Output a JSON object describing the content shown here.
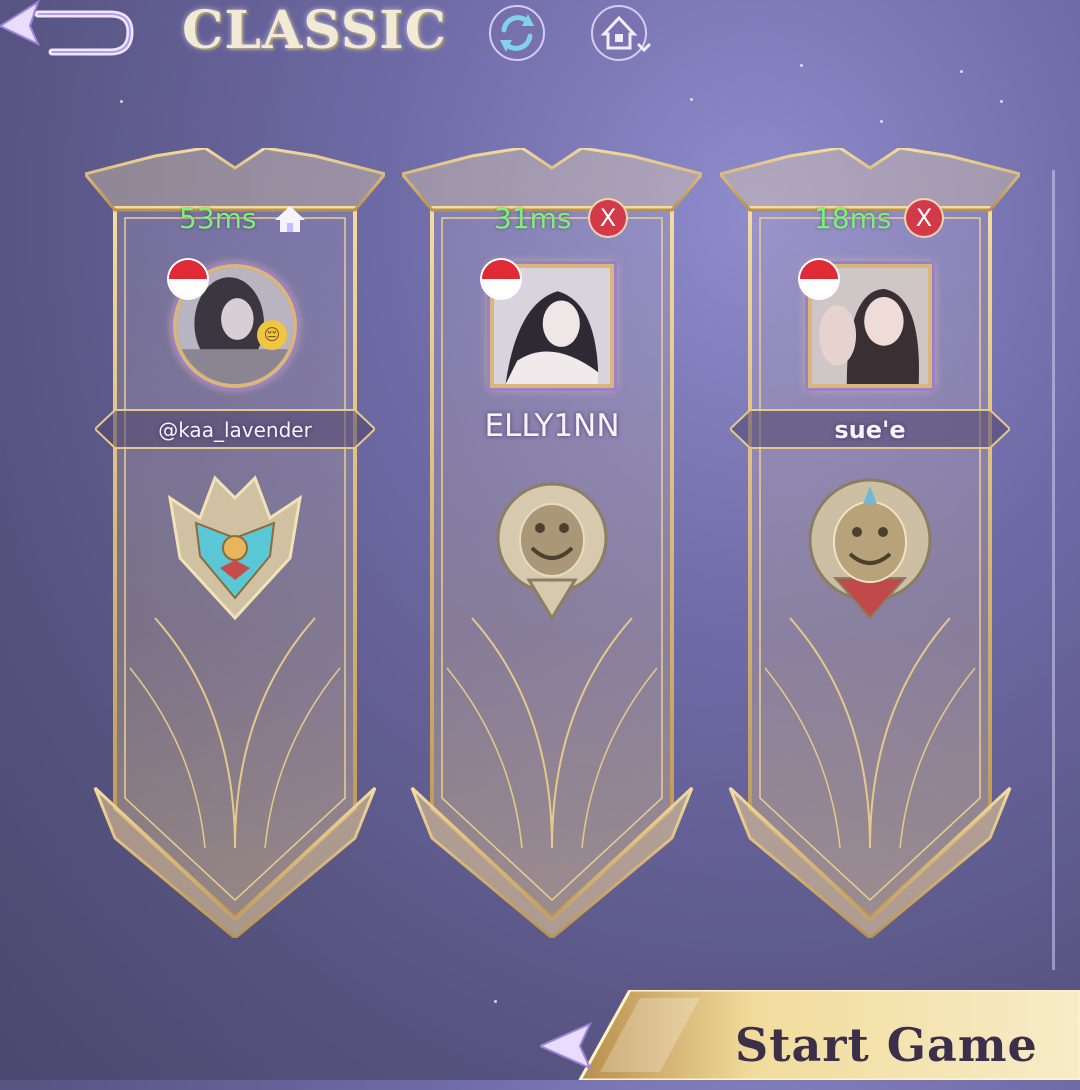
{
  "header": {
    "title": "CLASSIC"
  },
  "players": [
    {
      "ping": "53ms",
      "status": "host",
      "name": "@kaa_lavender",
      "flag": "red-white",
      "emoji": "😔"
    },
    {
      "ping": "31ms",
      "status": "X",
      "name": "ELLY1NN",
      "flag": "red-white"
    },
    {
      "ping": "18ms",
      "status": "X",
      "name": "sue'e",
      "flag": "red-white"
    }
  ],
  "footer": {
    "start_label": "Start Game"
  },
  "colors": {
    "gold": "#d9b77a",
    "ping_green": "#7ef07a",
    "kick_red": "#d23a4a",
    "background": "#6e6aa6"
  }
}
